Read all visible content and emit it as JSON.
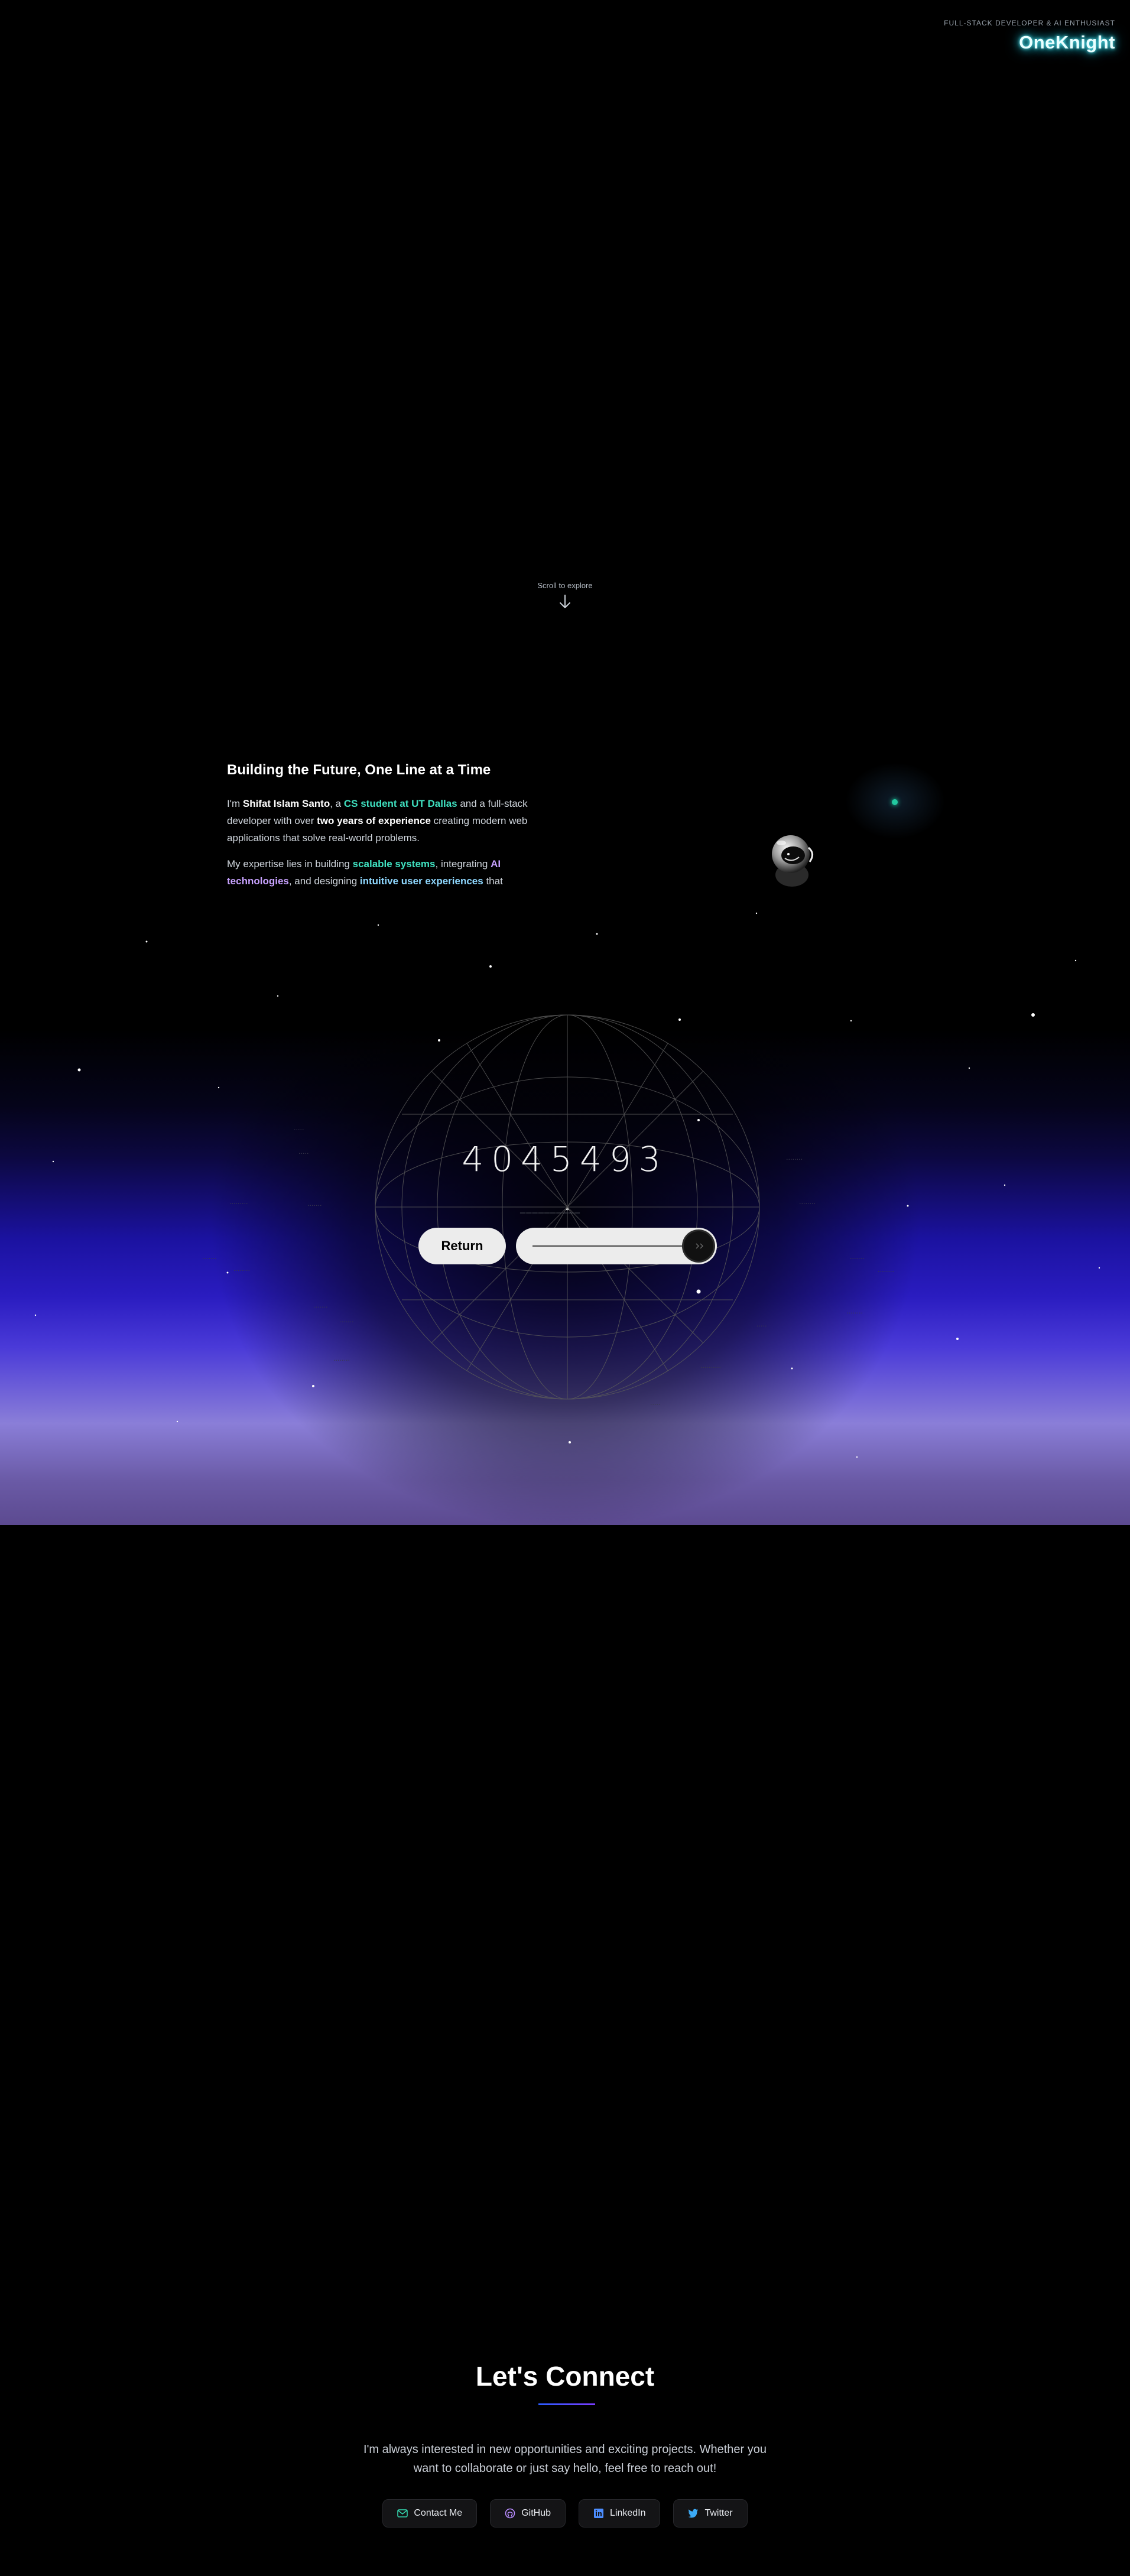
{
  "header": {
    "tagline": "FULL-STACK DEVELOPER & AI ENTHUSIAST",
    "logo": "OneKnight"
  },
  "hero": {
    "scroll_hint": "Scroll to explore"
  },
  "about": {
    "title": "Building the Future, One Line at a Time",
    "p1_im": "I'm ",
    "p1_name": "Shifat Islam Santo",
    "p1_a": ", a ",
    "p1_student": "CS student at UT Dallas",
    "p1_b": " and a full-stack developer with over ",
    "p1_exp": "two years of experience",
    "p1_c": " creating modern web applications that solve real-world problems.",
    "p2_a": "My expertise lies in building ",
    "p2_scalable": "scalable systems",
    "p2_b": ", integrating ",
    "p2_ai": "AI technologies",
    "p2_c": ", and designing ",
    "p2_ux": "intuitive user experiences",
    "p2_d": " that"
  },
  "galaxy": {
    "counter": "4045493",
    "return_label": "Return"
  },
  "connect": {
    "title": "Let's Connect",
    "text": "I'm always interested in new opportunities and exciting projects. Whether you want to collaborate or just say hello, feel free to reach out!",
    "buttons": [
      {
        "label": "Contact Me",
        "icon": "mail-icon"
      },
      {
        "label": "GitHub",
        "icon": "github-icon"
      },
      {
        "label": "LinkedIn",
        "icon": "linkedin-icon"
      },
      {
        "label": "Twitter",
        "icon": "twitter-icon"
      }
    ]
  },
  "colors": {
    "accent_teal": "#3fe0c0",
    "accent_violet": "#c8a2ff",
    "galaxy_blue": "#2a1cc0",
    "logo_glow": "#5ff3ff"
  }
}
